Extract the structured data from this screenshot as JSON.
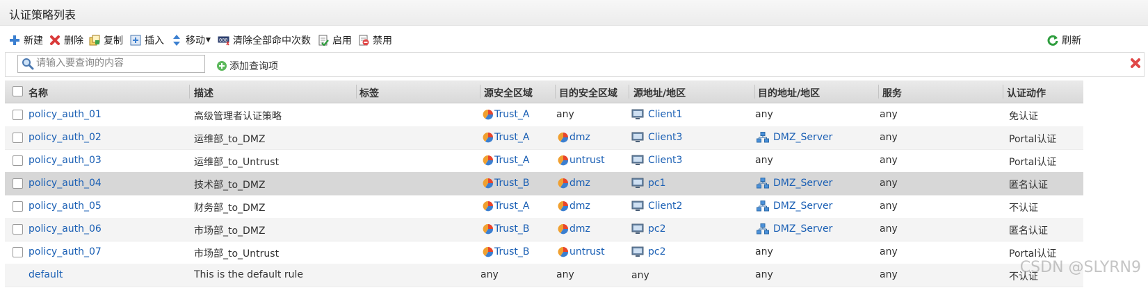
{
  "panel": {
    "title": "认证策略列表"
  },
  "toolbar": {
    "new": "新建",
    "delete": "删除",
    "copy": "复制",
    "insert": "插入",
    "move": "移动",
    "clear_hits": "清除全部命中次数",
    "enable": "启用",
    "disable": "禁用",
    "refresh": "刷新"
  },
  "filter": {
    "placeholder": "请输入要查询的内容",
    "add_query": "添加查询项"
  },
  "table": {
    "columns": {
      "name": "名称",
      "desc": "描述",
      "tag": "标签",
      "src_zone": "源安全区域",
      "dst_zone": "目的安全区域",
      "src_addr": "源地址/地区",
      "dst_addr": "目的地址/地区",
      "service": "服务",
      "action": "认证动作"
    },
    "rows": [
      {
        "name": "policy_auth_01",
        "desc": "高级管理者认证策略",
        "src_zone": "Trust_A",
        "dst_zone": "any",
        "src_addr": "Client1",
        "dst_addr": "any",
        "service": "any",
        "action": "免认证"
      },
      {
        "name": "policy_auth_02",
        "desc": "运维部_to_DMZ",
        "src_zone": "Trust_A",
        "dst_zone": "dmz",
        "src_addr": "Client3",
        "dst_addr": "DMZ_Server",
        "service": "any",
        "action": "Portal认证"
      },
      {
        "name": "policy_auth_03",
        "desc": "运维部_to_Untrust",
        "src_zone": "Trust_A",
        "dst_zone": "untrust",
        "src_addr": "Client3",
        "dst_addr": "any",
        "service": "any",
        "action": "Portal认证"
      },
      {
        "name": "policy_auth_04",
        "desc": "技术部_to_DMZ",
        "src_zone": "Trust_B",
        "dst_zone": "dmz",
        "src_addr": "pc1",
        "dst_addr": "DMZ_Server",
        "service": "any",
        "action": "匿名认证"
      },
      {
        "name": "policy_auth_05",
        "desc": "财务部_to_DMZ",
        "src_zone": "Trust_A",
        "dst_zone": "dmz",
        "src_addr": "Client2",
        "dst_addr": "DMZ_Server",
        "service": "any",
        "action": "不认证"
      },
      {
        "name": "policy_auth_06",
        "desc": "市场部_to_DMZ",
        "src_zone": "Trust_B",
        "dst_zone": "dmz",
        "src_addr": "pc2",
        "dst_addr": "DMZ_Server",
        "service": "any",
        "action": "匿名认证"
      },
      {
        "name": "policy_auth_07",
        "desc": "市场部_to_Untrust",
        "src_zone": "Trust_B",
        "dst_zone": "untrust",
        "src_addr": "pc2",
        "dst_addr": "any",
        "service": "any",
        "action": "Portal认证"
      },
      {
        "name": "default",
        "desc": "This is the default rule",
        "src_zone": "any",
        "dst_zone": "any",
        "src_addr": "any",
        "dst_addr": "any",
        "service": "any",
        "action": "不认证"
      }
    ]
  },
  "watermark": "CSDN @SLYRN9",
  "colors": {
    "link": "#1a5fb4",
    "selected_row": "#d7d7d7",
    "header_bg": "#dedede"
  }
}
